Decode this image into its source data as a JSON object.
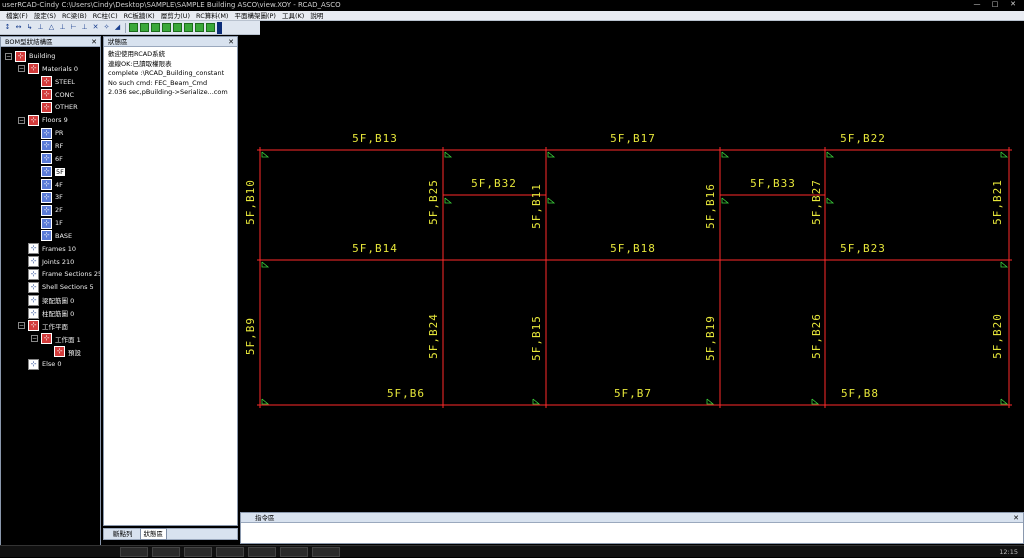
{
  "window": {
    "title": "userRCAD-Cindy  C:\\Users\\Cindy\\Desktop\\SAMPLE\\SAMPLE Building ASCO\\view.XOY - RCAD_ASCO",
    "minimize": "—",
    "maximize": "□",
    "close": "✕"
  },
  "menu": [
    "檔案(F)",
    "設定(S)",
    "RC梁(B)",
    "RC柱(C)",
    "RC板牆(K)",
    "層剪力(U)",
    "RC算料(M)",
    "平面構架圖(P)",
    "工具(K)",
    "說明"
  ],
  "toolbar": {
    "icons": [
      "↕",
      "↔",
      "↳",
      "⊥",
      "△",
      "⊥",
      "⊢",
      "⊥",
      "✕",
      "✧",
      "◢"
    ],
    "green_count": 8
  },
  "tree": {
    "title": "BOM型狀結構區",
    "close": "✕",
    "items": [
      {
        "label": "Building",
        "level": 0,
        "exp": "−",
        "icon": "red"
      },
      {
        "label": "Materials 0",
        "level": 1,
        "exp": "−",
        "icon": "red"
      },
      {
        "label": "STEEL",
        "level": 2,
        "exp": "",
        "icon": "red"
      },
      {
        "label": "CONC",
        "level": 2,
        "exp": "",
        "icon": "red"
      },
      {
        "label": "OTHER",
        "level": 2,
        "exp": "",
        "icon": "red"
      },
      {
        "label": "Floors 9",
        "level": 1,
        "exp": "−",
        "icon": "red"
      },
      {
        "label": "PR",
        "level": 2,
        "exp": "",
        "icon": "blue"
      },
      {
        "label": "RF",
        "level": 2,
        "exp": "",
        "icon": "blue"
      },
      {
        "label": "6F",
        "level": 2,
        "exp": "",
        "icon": "blue"
      },
      {
        "label": "5F",
        "level": 2,
        "exp": "",
        "icon": "blue",
        "selected": true
      },
      {
        "label": "4F",
        "level": 2,
        "exp": "",
        "icon": "blue"
      },
      {
        "label": "3F",
        "level": 2,
        "exp": "",
        "icon": "blue"
      },
      {
        "label": "2F",
        "level": 2,
        "exp": "",
        "icon": "blue"
      },
      {
        "label": "1F",
        "level": 2,
        "exp": "",
        "icon": "blue"
      },
      {
        "label": "BASE",
        "level": 2,
        "exp": "",
        "icon": "blue"
      },
      {
        "label": "Frames 10",
        "level": 1,
        "exp": "",
        "icon": "white"
      },
      {
        "label": "Joints 210",
        "level": 1,
        "exp": "",
        "icon": "white"
      },
      {
        "label": "Frame Sections 25",
        "level": 1,
        "exp": "",
        "icon": "white"
      },
      {
        "label": "Shell Sections 5",
        "level": 1,
        "exp": "",
        "icon": "white"
      },
      {
        "label": "梁配筋圖 0",
        "level": 1,
        "exp": "",
        "icon": "white"
      },
      {
        "label": "柱配筋圖 0",
        "level": 1,
        "exp": "",
        "icon": "white"
      },
      {
        "label": "工作平面",
        "level": 1,
        "exp": "−",
        "icon": "red"
      },
      {
        "label": "工作面 1",
        "level": 2,
        "exp": "−",
        "icon": "red"
      },
      {
        "label": "預設",
        "level": 3,
        "exp": "",
        "icon": "red"
      },
      {
        "label": "Else 0",
        "level": 1,
        "exp": "",
        "icon": "white"
      }
    ]
  },
  "status": {
    "title": "狀態區",
    "close": "✕",
    "lines": [
      "歡迎使用RCAD系統",
      "連線OK:已讀取權限表",
      "complete :\\RCAD_Building_constant",
      "No such cmd: FEC_Beam_Cmd",
      "2.036 sec,pBuilding->Serialize...com"
    ],
    "tabs": [
      "斷點列",
      "狀態區"
    ]
  },
  "drawing": {
    "colors": {
      "line": "#ff2a2a",
      "text": "#e6e63a",
      "support": "#3dd43d"
    },
    "labels": [
      "5F,B13",
      "5F,B17",
      "5F,B22",
      "5F,B32",
      "5F,B33",
      "5F,B14",
      "5F,B18",
      "5F,B23",
      "5F,B6",
      "5F,B7",
      "5F,B8",
      "5F,B10",
      "5F,B25",
      "5F,B11",
      "5F,B16",
      "5F,B27",
      "5F,B21",
      "5F,B9",
      "5F,B24",
      "5F,B15",
      "5F,B19",
      "5F,B26",
      "5F,B20"
    ]
  },
  "command": {
    "title": "指令區",
    "close": "✕"
  },
  "taskbar": {
    "clock": "12:15"
  }
}
